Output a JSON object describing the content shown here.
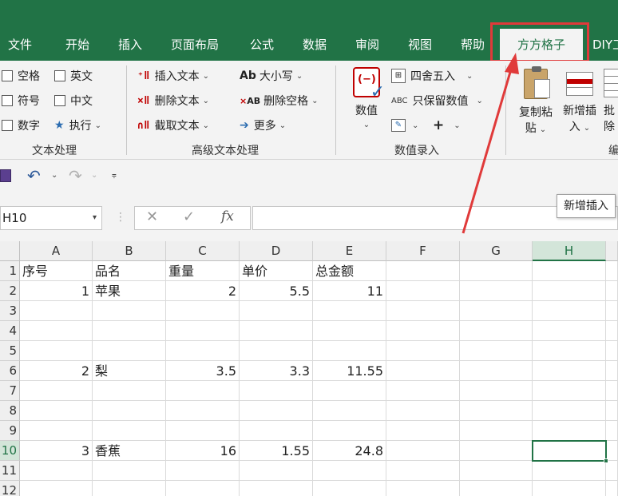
{
  "tabs": [
    {
      "label": "文件"
    },
    {
      "label": "开始"
    },
    {
      "label": "插入"
    },
    {
      "label": "页面布局"
    },
    {
      "label": "公式"
    },
    {
      "label": "数据"
    },
    {
      "label": "审阅"
    },
    {
      "label": "视图"
    },
    {
      "label": "帮助"
    },
    {
      "label": "方方格子"
    },
    {
      "label": "DIY工"
    }
  ],
  "ribbon": {
    "text_group": {
      "label": "文本处理",
      "checkboxes": [
        {
          "label": "空格"
        },
        {
          "label": "英文"
        },
        {
          "label": "符号"
        },
        {
          "label": "中文"
        },
        {
          "label": "数字"
        }
      ],
      "execute": "执行"
    },
    "advanced_group": {
      "label": "高级文本处理",
      "insert_text": "插入文本",
      "delete_text": "删除文本",
      "cut_text": "截取文本",
      "case": "大小写",
      "delete_space": "删除空格",
      "more": "更多"
    },
    "numeric_group": {
      "label": "数值录入",
      "numeric": "数值",
      "round": "四舍五入",
      "keep_numeric": "只保留数值"
    },
    "edit_group": {
      "label": "编",
      "copy_paste": "复制粘",
      "copy_paste_2": "贴",
      "new_insert": "新增插",
      "new_insert_2": "入",
      "batch": "批",
      "batch_2": "除"
    }
  },
  "namebox": "H10",
  "tooltip": "新增插入",
  "columns": [
    "A",
    "B",
    "C",
    "D",
    "E",
    "F",
    "G",
    "H"
  ],
  "rows": [
    "1",
    "2",
    "3",
    "4",
    "5",
    "6",
    "7",
    "8",
    "9",
    "10",
    "11",
    "12"
  ],
  "sheet": {
    "headers": [
      "序号",
      "品名",
      "重量",
      "单价",
      "总金额"
    ],
    "row2": [
      "1",
      "苹果",
      "2",
      "5.5",
      "11"
    ],
    "row6": [
      "2",
      "梨",
      "3.5",
      "3.3",
      "11.55"
    ],
    "row10": [
      "3",
      "香蕉",
      "16",
      "1.55",
      "24.8"
    ]
  },
  "colors": {
    "accent": "#217346",
    "highlight": "#e03a3a"
  }
}
